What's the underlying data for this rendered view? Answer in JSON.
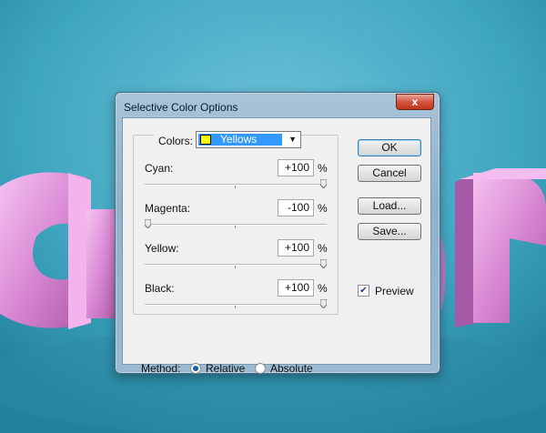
{
  "dialog": {
    "title": "Selective Color Options",
    "close_label": "x"
  },
  "colors": {
    "label": "Colors:",
    "selected": "Yellows",
    "swatch_color": "#ffff00"
  },
  "sliders": [
    {
      "label": "Cyan:",
      "value": "+100",
      "unit": "%",
      "level": 100
    },
    {
      "label": "Magenta:",
      "value": "-100",
      "unit": "%",
      "level": -100
    },
    {
      "label": "Yellow:",
      "value": "+100",
      "unit": "%",
      "level": 100
    },
    {
      "label": "Black:",
      "value": "+100",
      "unit": "%",
      "level": 100
    }
  ],
  "buttons": {
    "ok": "OK",
    "cancel": "Cancel",
    "load": "Load...",
    "save": "Save..."
  },
  "preview": {
    "label": "Preview",
    "checked": true
  },
  "method": {
    "label": "Method:",
    "options": [
      "Relative",
      "Absolute"
    ],
    "selected": "Relative"
  },
  "background_colors": {
    "teal": "#3fa6c0",
    "pink": "#d98ad4"
  }
}
